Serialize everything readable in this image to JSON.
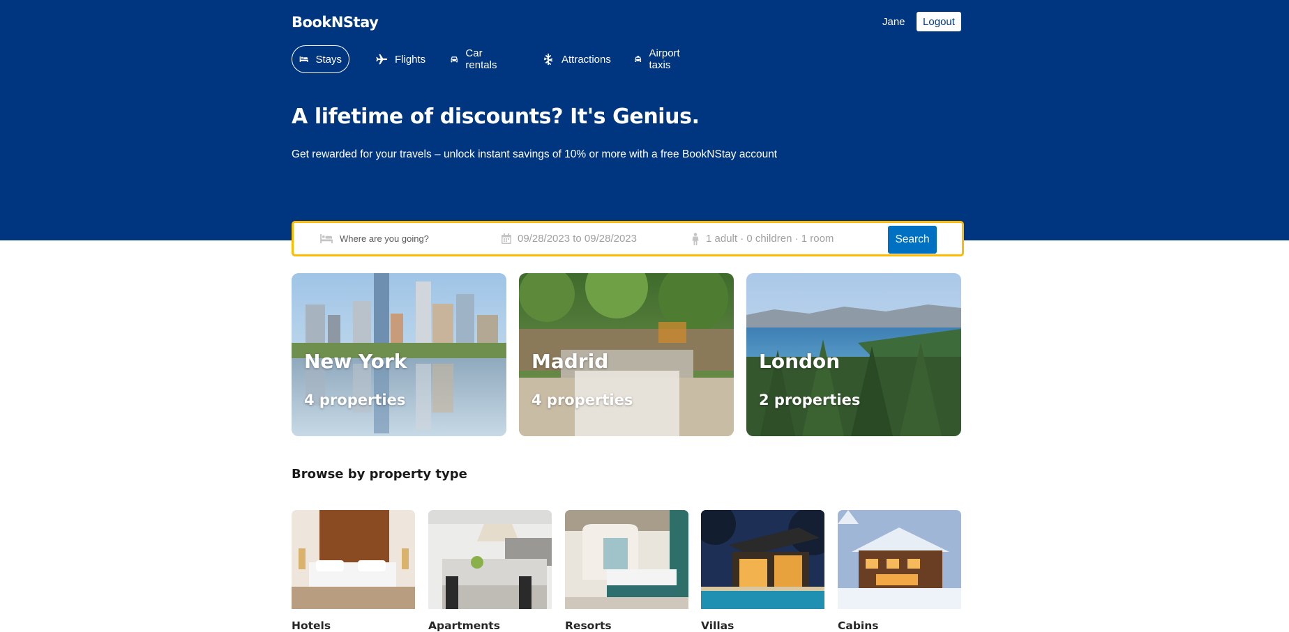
{
  "app": {
    "logo": "BookNStay"
  },
  "user": {
    "name": "Jane",
    "logout_label": "Logout"
  },
  "nav": {
    "items": [
      {
        "label": "Stays",
        "icon": "bed-icon",
        "active": true
      },
      {
        "label": "Flights",
        "icon": "plane-icon",
        "active": false
      },
      {
        "label": "Car rentals",
        "icon": "car-icon",
        "active": false
      },
      {
        "label": "Attractions",
        "icon": "snowflake-icon",
        "active": false
      },
      {
        "label": "Airport taxis",
        "icon": "taxi-icon",
        "active": false
      }
    ]
  },
  "hero": {
    "title": "A lifetime of discounts? It's Genius.",
    "subtitle": "Get rewarded for your travels – unlock instant savings of 10% or more with a free BookNStay account"
  },
  "search": {
    "destination_placeholder": "Where are you going?",
    "dates": "09/28/2023 to 09/28/2023",
    "guests": "1 adult · 0 children · 1 room",
    "button_label": "Search"
  },
  "featured": [
    {
      "city": "New York",
      "count": "4 properties"
    },
    {
      "city": "Madrid",
      "count": "4 properties"
    },
    {
      "city": "London",
      "count": "2 properties"
    }
  ],
  "property_types": {
    "title": "Browse by property type",
    "items": [
      {
        "label": "Hotels"
      },
      {
        "label": "Apartments"
      },
      {
        "label": "Resorts"
      },
      {
        "label": "Villas"
      },
      {
        "label": "Cabins"
      }
    ]
  },
  "colors": {
    "header_bg": "#003580",
    "search_border": "#febb02",
    "search_button": "#0071c2"
  }
}
